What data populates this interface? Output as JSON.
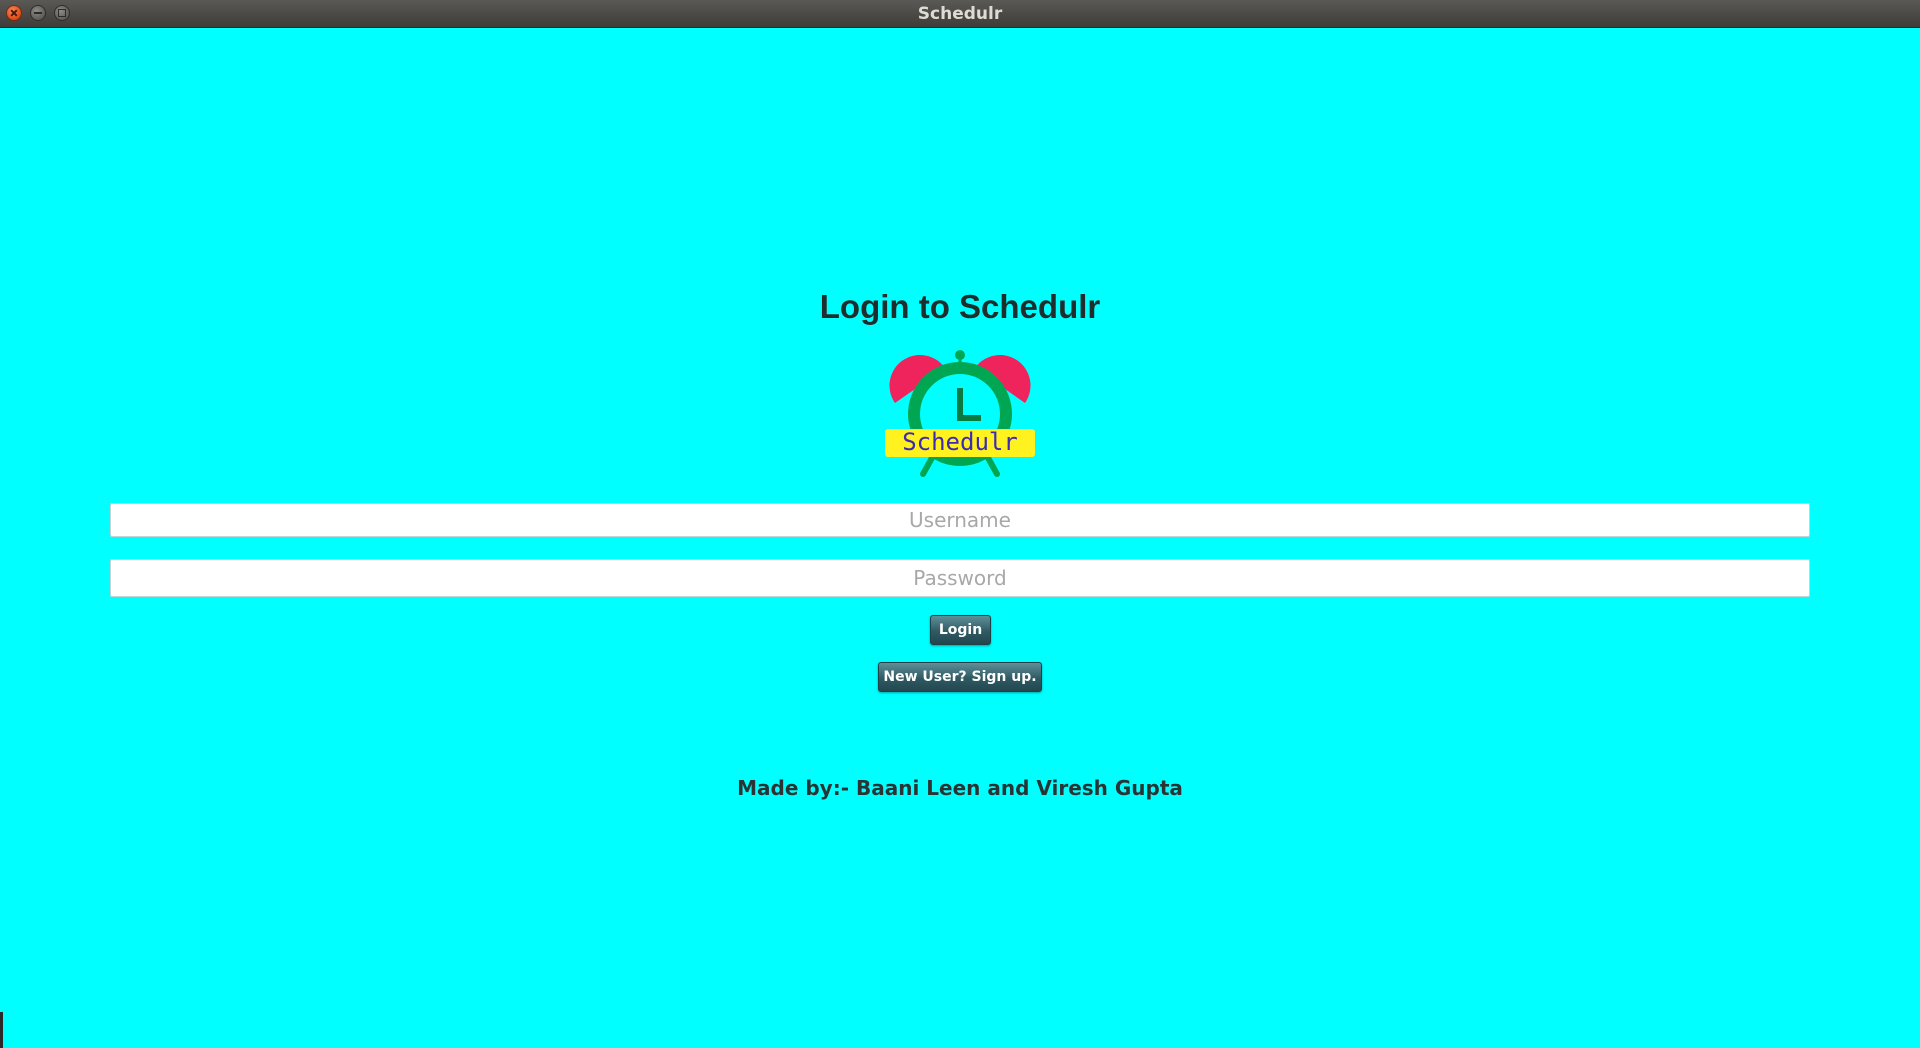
{
  "window": {
    "title": "Schedulr"
  },
  "login": {
    "heading": "Login to Schedulr",
    "logo_text": "Schedulr",
    "username_placeholder": "Username",
    "username_value": "",
    "password_placeholder": "Password",
    "password_value": "",
    "login_label": "Login",
    "signup_label": "New User? Sign up."
  },
  "footer": {
    "credits": "Made by:- Baani Leen and Viresh Gupta"
  },
  "colors": {
    "background": "#00ffff",
    "button": "#2f5a63",
    "logo_bells": "#f0245c",
    "logo_clock": "#00a651",
    "logo_banner": "#fff21f",
    "logo_text": "#3b2bb5"
  },
  "icons": {
    "logo": "alarm-clock-icon",
    "close": "close-icon",
    "minimize": "minimize-icon",
    "maximize": "maximize-icon"
  }
}
